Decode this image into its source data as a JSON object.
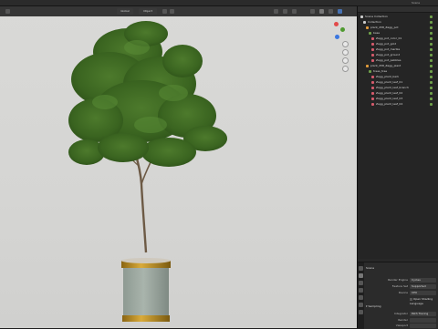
{
  "topbar": {
    "tab_label": "Scene"
  },
  "viewport": {
    "header": {
      "shading_mode": "Global",
      "mode_label": "Object"
    }
  },
  "outliner": {
    "title": "Scene Collection",
    "rows": [
      {
        "label": "Scene Collection",
        "color": "#cccccc"
      },
      {
        "label": "Collection",
        "color": "#cccccc"
      },
      {
        "label": "plant_458_Zagg_pot",
        "color": "#e29b3b"
      },
      {
        "label": "base",
        "color": "#6fa04a"
      },
      {
        "label": "Zagg_pot_color_01",
        "color": "#d35a6b"
      },
      {
        "label": "Zagg_pot_gold",
        "color": "#d35a6b"
      },
      {
        "label": "Zagg_pot_marble",
        "color": "#d35a6b"
      },
      {
        "label": "Zagg_pot_ground",
        "color": "#d35a6b"
      },
      {
        "label": "Zagg_pot_pebbles",
        "color": "#d35a6b"
      },
      {
        "label": "plant_458_Zagg_plant",
        "color": "#e29b3b"
      },
      {
        "label": "trees_tree",
        "color": "#6fa04a"
      },
      {
        "label": "Zagg_plant_bark",
        "color": "#d35a6b"
      },
      {
        "label": "Zagg_plant_leaf_01",
        "color": "#d35a6b"
      },
      {
        "label": "Zagg_plant_leaf_branch",
        "color": "#d35a6b"
      },
      {
        "label": "Zagg_plant_leaf_02",
        "color": "#d35a6b"
      },
      {
        "label": "Zagg_plant_leaf_03",
        "color": "#d35a6b"
      },
      {
        "label": "Zagg_plant_leaf_04",
        "color": "#d35a6b"
      }
    ]
  },
  "properties": {
    "title": "Scene",
    "fields": [
      {
        "label": "Render Engine",
        "value": "Cycles"
      },
      {
        "label": "Feature Set",
        "value": "Supported"
      },
      {
        "label": "Device",
        "value": "CPU"
      }
    ],
    "checkbox_label": "Open Shading Language",
    "section": "Sampling",
    "sub": [
      {
        "label": "Integrator",
        "value": "Path Tracing"
      },
      {
        "label": "Render",
        "value": ""
      },
      {
        "label": "Viewport",
        "value": ""
      }
    ]
  }
}
